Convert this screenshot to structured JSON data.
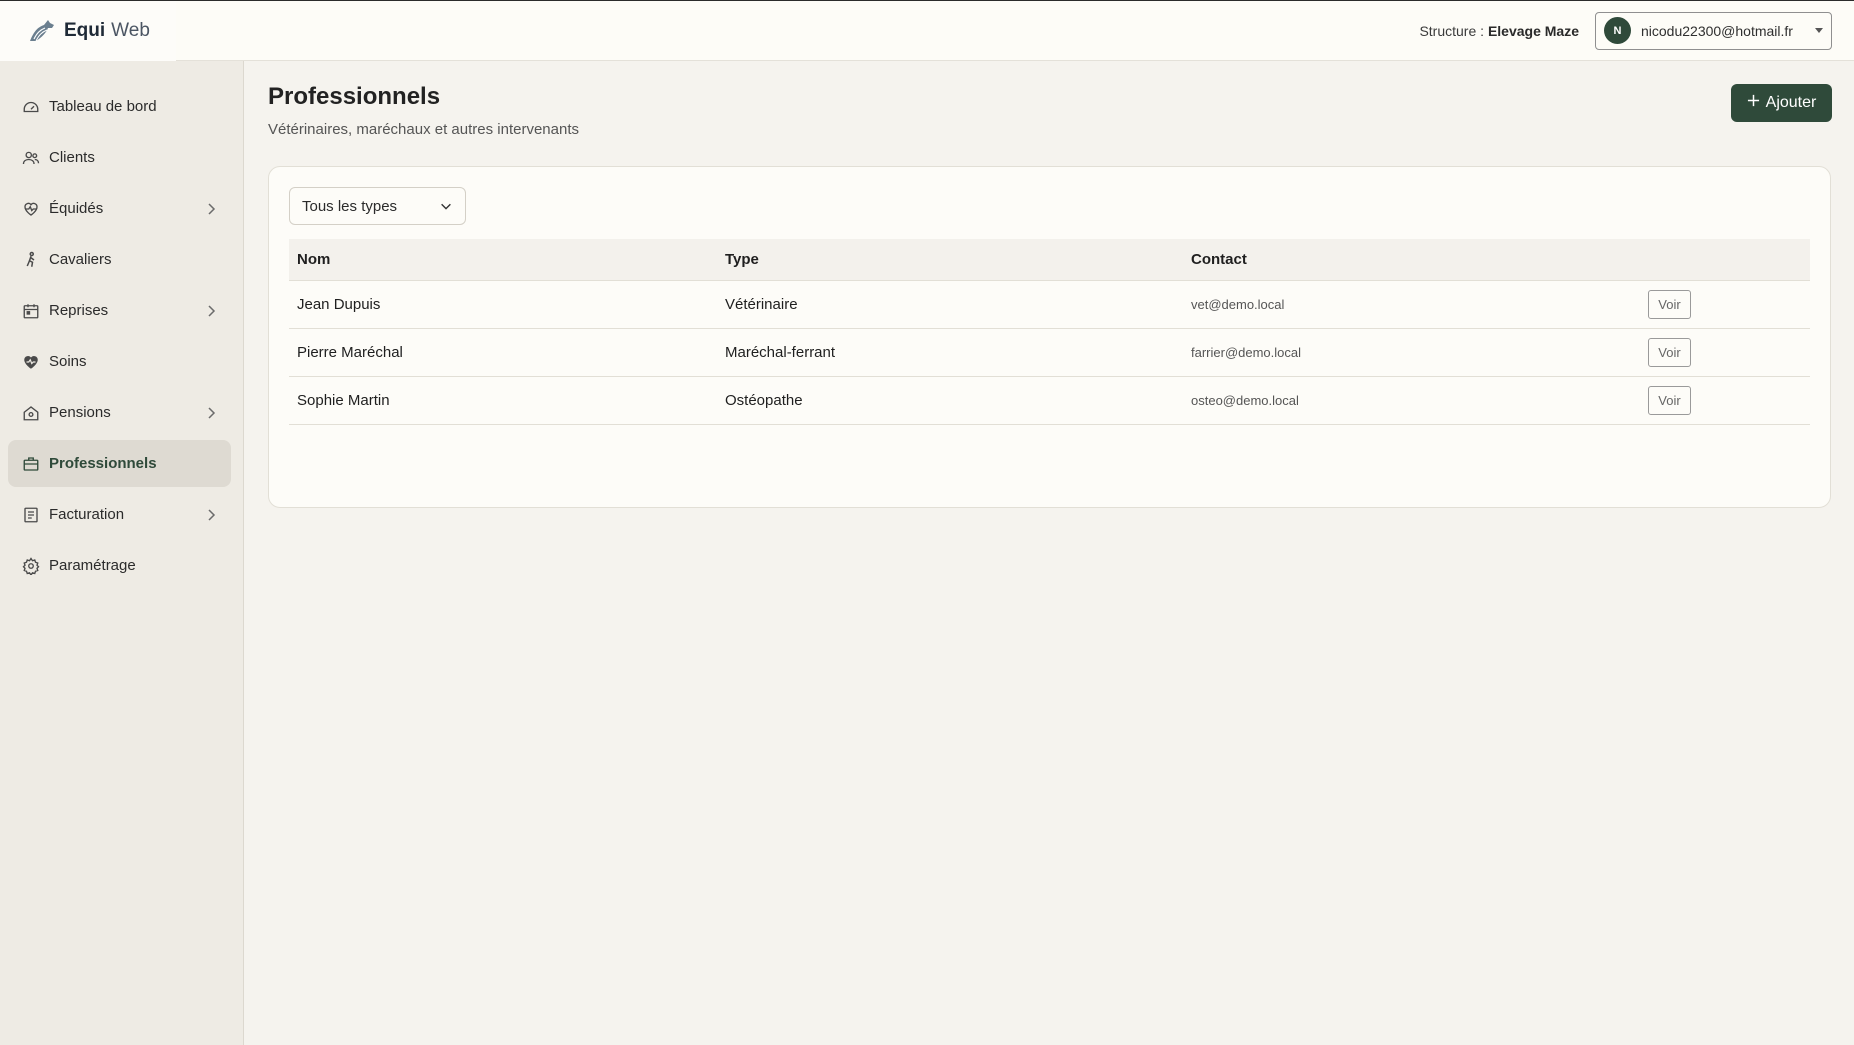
{
  "brand": {
    "name_bold": "Equi",
    "name_light": "Web"
  },
  "header": {
    "structure_label": "Structure :",
    "structure_name": "Elevage Maze",
    "user_initial": "N",
    "user_email": "nicodu22300@hotmail.fr"
  },
  "sidebar": {
    "items": [
      {
        "label": "Tableau de bord",
        "icon": "gauge-icon",
        "has_chevron": false,
        "active": false
      },
      {
        "label": "Clients",
        "icon": "users-icon",
        "has_chevron": false,
        "active": false
      },
      {
        "label": "Équidés",
        "icon": "heart-pulse-icon",
        "has_chevron": true,
        "active": false
      },
      {
        "label": "Cavaliers",
        "icon": "rider-icon",
        "has_chevron": false,
        "active": false
      },
      {
        "label": "Reprises",
        "icon": "calendar-icon",
        "has_chevron": true,
        "active": false
      },
      {
        "label": "Soins",
        "icon": "heart-icon",
        "has_chevron": false,
        "active": false
      },
      {
        "label": "Pensions",
        "icon": "house-icon",
        "has_chevron": true,
        "active": false
      },
      {
        "label": "Professionnels",
        "icon": "briefcase-icon",
        "has_chevron": false,
        "active": true
      },
      {
        "label": "Facturation",
        "icon": "invoice-icon",
        "has_chevron": true,
        "active": false
      },
      {
        "label": "Paramétrage",
        "icon": "gear-icon",
        "has_chevron": false,
        "active": false
      }
    ]
  },
  "main": {
    "title": "Professionnels",
    "subtitle": "Vétérinaires, maréchaux et autres intervenants",
    "add_label": "Ajouter",
    "filter": {
      "selected": "Tous les types"
    },
    "table": {
      "headers": [
        "Nom",
        "Type",
        "Contact",
        ""
      ],
      "rows": [
        {
          "name": "Jean Dupuis",
          "type": "Vétérinaire",
          "contact": "vet@demo.local",
          "action": "Voir"
        },
        {
          "name": "Pierre Maréchal",
          "type": "Maréchal-ferrant",
          "contact": "farrier@demo.local",
          "action": "Voir"
        },
        {
          "name": "Sophie Martin",
          "type": "Ostéopathe",
          "contact": "osteo@demo.local",
          "action": "Voir"
        }
      ]
    }
  },
  "colors": {
    "accent": "#2f4a3a",
    "background": "#f5f3ee",
    "sidebar": "#eeebe4"
  }
}
